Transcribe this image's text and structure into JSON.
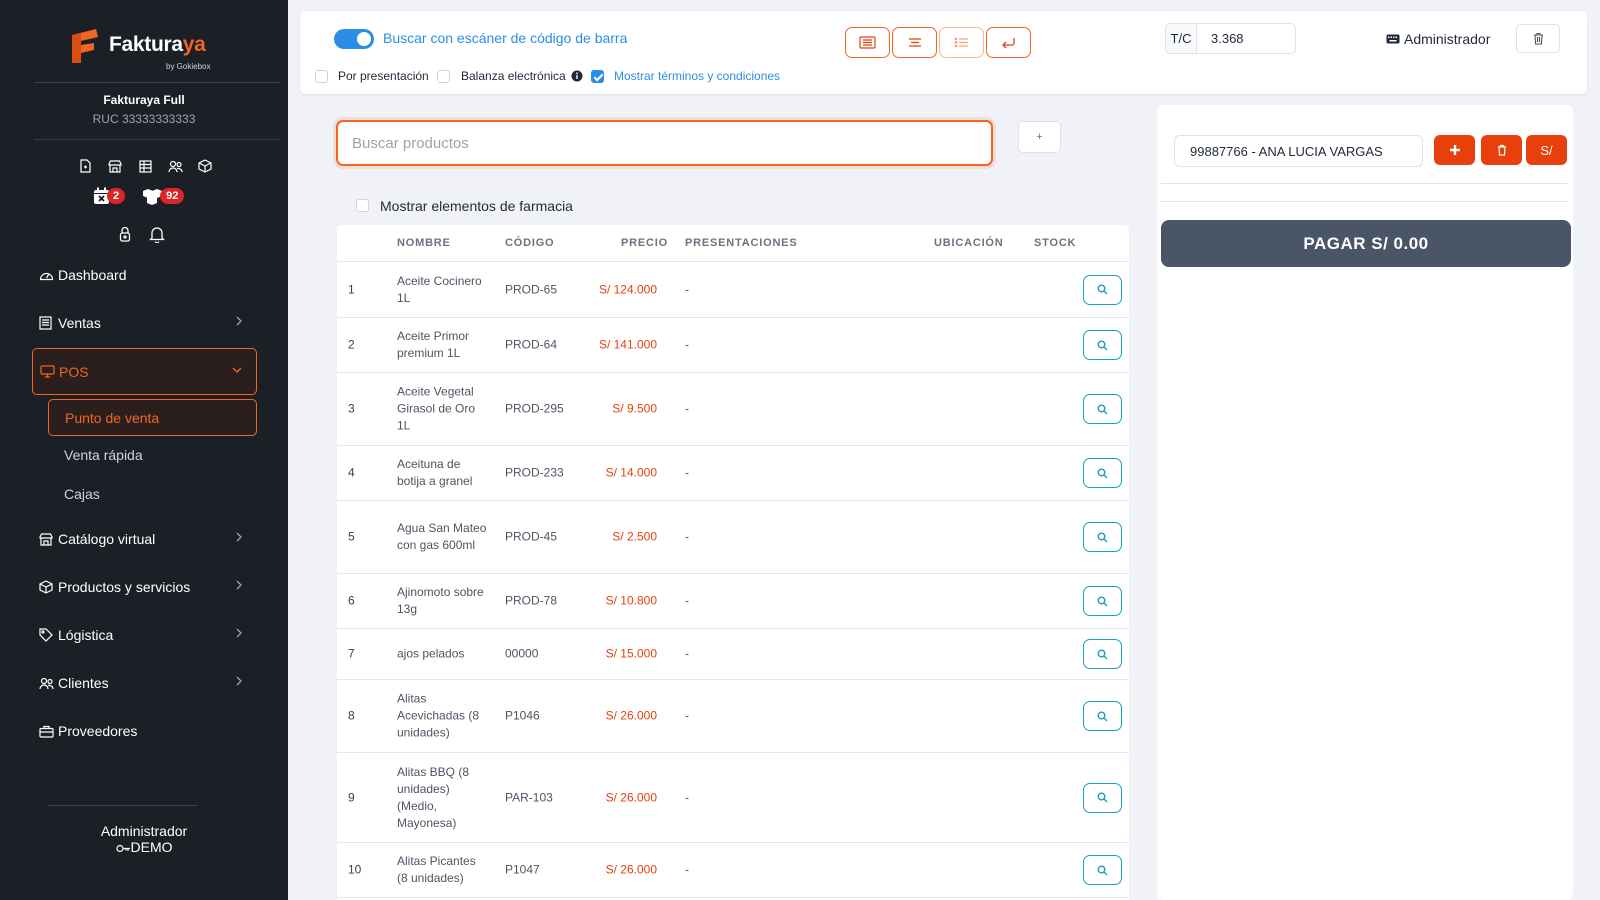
{
  "app": {
    "brand_main": "Faktura",
    "brand_accent": "ya",
    "brand_sub": "by Gokiebox",
    "company_name": "Fakturaya Full",
    "company_ruc": "RUC 33333333333"
  },
  "sidebar": {
    "badges": {
      "calendar_count": "2",
      "boxes_count": "92"
    },
    "nav": {
      "dashboard": "Dashboard",
      "ventas": "Ventas",
      "pos": "POS",
      "punto_venta": "Punto de venta",
      "venta_rapida": "Venta rápida",
      "cajas": "Cajas",
      "catalogo": "Catálogo virtual",
      "productos": "Productos y servicios",
      "logistica": "Lógistica",
      "clientes": "Clientes",
      "proveedores": "Proveedores"
    },
    "user_role": "Administrador",
    "user_env": "DEMO"
  },
  "topbar": {
    "scanner_label": "Buscar con escáner de código de barra",
    "por_presentacion": "Por presentación",
    "balanza": "Balanza electrónica",
    "terminos": "Mostrar términos y condiciones",
    "tc_label": "T/C",
    "tc_value": "3.368",
    "admin_label": "Administrador"
  },
  "search": {
    "placeholder": "Buscar productos",
    "plus_label": "+",
    "pharmacy_label": "Mostrar elementos de farmacia"
  },
  "table": {
    "headers": {
      "nombre": "NOMBRE",
      "codigo": "CÓDIGO",
      "precio": "PRECIO",
      "presentaciones": "PRESENTACIONES",
      "ubicacion": "UBICACIÓN",
      "stock": "STOCK"
    },
    "rows": [
      {
        "num": "1",
        "name": "Aceite Cocinero 1L",
        "code": "PROD-65",
        "price": "S/ 124.000",
        "pres": "-"
      },
      {
        "num": "2",
        "name": "Aceite Primor premium 1L",
        "code": "PROD-64",
        "price": "S/ 141.000",
        "pres": "-"
      },
      {
        "num": "3",
        "name": "Aceite Vegetal Girasol de Oro 1L",
        "code": "PROD-295",
        "price": "S/ 9.500",
        "pres": "-"
      },
      {
        "num": "4",
        "name": "Aceituna de botija a granel",
        "code": "PROD-233",
        "price": "S/ 14.000",
        "pres": "-"
      },
      {
        "num": "5",
        "name": "Agua San Mateo con gas 600ml",
        "code": "PROD-45",
        "price": "S/ 2.500",
        "pres": "-"
      },
      {
        "num": "6",
        "name": "Ajinomoto sobre 13g",
        "code": "PROD-78",
        "price": "S/ 10.800",
        "pres": "-"
      },
      {
        "num": "7",
        "name": "ajos pelados",
        "code": "00000",
        "price": "S/ 15.000",
        "pres": "-"
      },
      {
        "num": "8",
        "name": "Alitas Acevichadas (8 unidades)",
        "code": "P1046",
        "price": "S/ 26.000",
        "pres": "-"
      },
      {
        "num": "9",
        "name": "Alitas BBQ (8 unidades) (Medio, Mayonesa)",
        "code": "PAR-103",
        "price": "S/ 26.000",
        "pres": "-"
      },
      {
        "num": "10",
        "name": "Alitas Picantes (8 unidades)",
        "code": "P1047",
        "price": "S/ 26.000",
        "pres": "-"
      }
    ]
  },
  "right_panel": {
    "client_value": "99887766 - ANA LUCIA VARGAS",
    "currency_label": "S/",
    "pay_label": "PAGAR S/ 0.00"
  },
  "colors": {
    "brand_orange": "#f26522",
    "price_red": "#e8400c",
    "accent_blue": "#2b8ee6",
    "sidebar_bg": "#1b1f26",
    "pay_button": "#4b5568",
    "search_button_teal": "#19a2b8"
  },
  "icons": {
    "quick": [
      "document-icon",
      "store-icon",
      "table-icon",
      "users-icon",
      "box-icon"
    ],
    "system": [
      "lock-icon",
      "bell-icon"
    ]
  }
}
